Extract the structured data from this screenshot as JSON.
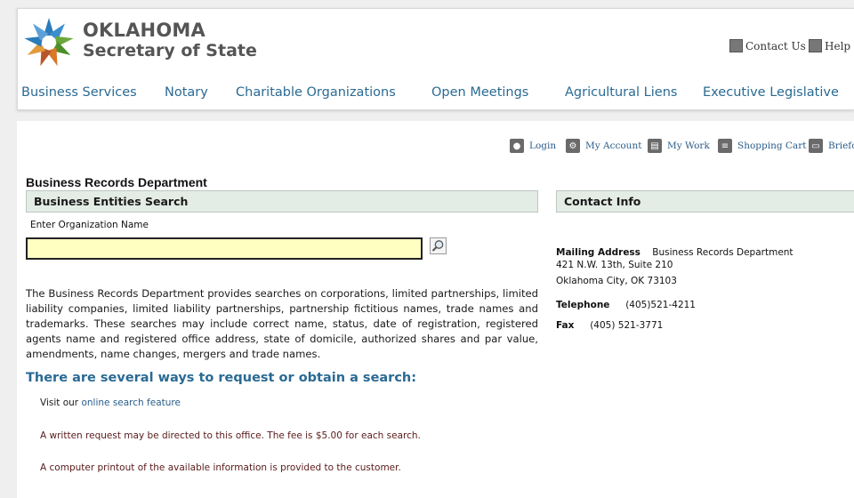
{
  "brand": {
    "line1": "OKLAHOMA",
    "line2": "Secretary of State"
  },
  "utility_links": [
    {
      "label": "Contact Us",
      "icon": "contact-icon"
    },
    {
      "label": "Help",
      "icon": "mail-icon"
    }
  ],
  "nav": [
    "Business Services",
    "Notary",
    "Charitable Organizations",
    "Open Meetings",
    "Agricultural Liens",
    "Executive Legislative"
  ],
  "account_bar": [
    {
      "label": "Login",
      "icon": "login-icon"
    },
    {
      "label": "My Account",
      "icon": "gear-icon"
    },
    {
      "label": "My Work",
      "icon": "clipboard-icon"
    },
    {
      "label": "Shopping Cart",
      "icon": "cart-icon"
    },
    {
      "label": "Briefca",
      "icon": "folder-icon"
    }
  ],
  "main": {
    "dept_title": "Business Records Department",
    "search_section": "Business Entities Search",
    "field_label": "Enter Organization Name",
    "org_name_value": "",
    "description": "The Business Records Department provides searches on corporations, limited partnerships, limited liability companies, limited liability partnerships, partnership fictitious names, trade names and trademarks. These searches may include correct name, status, date of registration, registered agents name and registered office address, state of domicile, authorized shares and par value, amendments, name changes, mergers and trade names.",
    "ways_heading": "There are several ways to request or obtain a search:",
    "way1_prefix": "Visit our",
    "way1_link": "online search feature",
    "way2": "A written request may be directed to this office. The fee is $5.00 for each search.",
    "way3": "A computer printout of the available information is provided to the customer."
  },
  "contact": {
    "section": "Contact Info",
    "mailing_label": "Mailing Address",
    "mailing_line1": "Business Records Department",
    "mailing_line2": "421 N.W. 13th, Suite 210",
    "mailing_line3": "Oklahoma City, OK 73103",
    "telephone_label": "Telephone",
    "telephone": "(405)521-4211",
    "fax_label": "Fax",
    "fax": "(405) 521-3771"
  },
  "colors": {
    "nav_link": "#2a6a93",
    "section_bar": "#e4ece6",
    "input_bg": "#ffffc2",
    "logo_blue": "#2b7bb9",
    "logo_green": "#6aa83b",
    "logo_orange": "#d9782a"
  }
}
